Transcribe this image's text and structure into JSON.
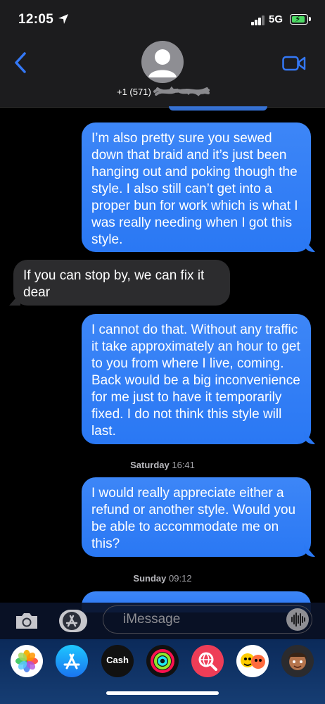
{
  "status": {
    "time": "12:05",
    "network": "5G"
  },
  "header": {
    "contact_number": "+1 (571)"
  },
  "messages": [
    {
      "direction": "sent",
      "text": "I’m also pretty sure you sewed down that braid and it’s just been hanging out and poking though the style. I also still can’t get into a proper bun for work which is what I was really needing when I got this style."
    },
    {
      "direction": "received",
      "text": "If you can stop by, we can fix it dear"
    },
    {
      "direction": "sent",
      "text": "I cannot do that. Without any traffic it take approximately an hour to get to you from where I live, coming. Back would be a big inconvenience for me just to have it temporarily fixed. I do not think this style will last."
    },
    {
      "direction": "sent",
      "text": "I would really appreciate either a refund or another style. Would you be able to accommodate me on this?"
    }
  ],
  "timestamps": [
    {
      "day": "Saturday",
      "time": "16:41"
    },
    {
      "day": "Sunday",
      "time": "09:12"
    }
  ],
  "compose": {
    "placeholder": "iMessage"
  },
  "app_tray": {
    "apps": [
      "photos-app-icon",
      "app-store-icon",
      "apple-cash-icon",
      "activity-icon",
      "web-search-icon",
      "memoji-stickers-icon",
      "memoji-icon"
    ],
    "cash_label": "Cash"
  },
  "colors": {
    "sent_bubble": "#2f7ef6",
    "received_bubble": "#2c2c2e",
    "accent": "#3478f6"
  }
}
